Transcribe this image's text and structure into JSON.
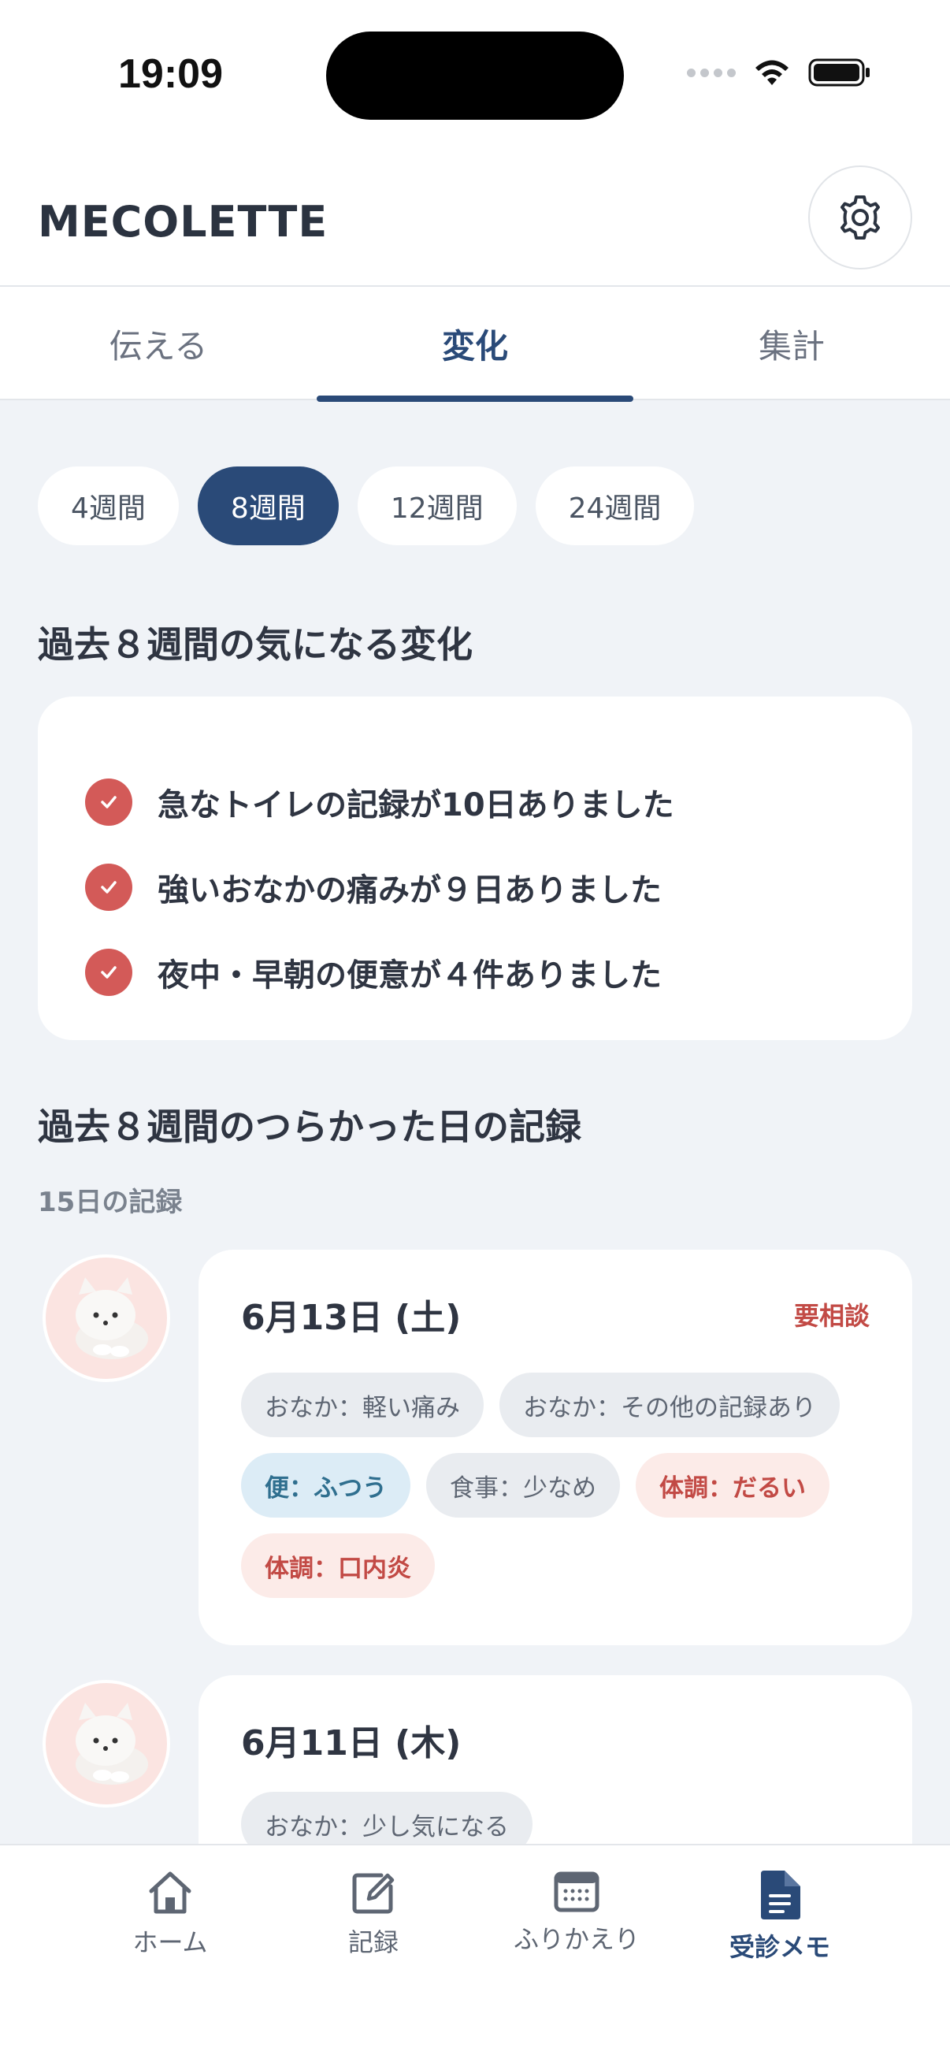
{
  "status_bar": {
    "time": "19:09"
  },
  "header": {
    "brand": "MECOLETTE"
  },
  "tabs": [
    {
      "label": "伝える",
      "active": false
    },
    {
      "label": "変化",
      "active": true
    },
    {
      "label": "集計",
      "active": false
    }
  ],
  "periods": [
    {
      "label": "4週間",
      "active": false
    },
    {
      "label": "8週間",
      "active": true
    },
    {
      "label": "12週間",
      "active": false
    },
    {
      "label": "24週間",
      "active": false
    }
  ],
  "changes": {
    "title": "過去８週間の気になる変化",
    "items": [
      "急なトイレの記録が10日ありました",
      "強いおなかの痛みが９日ありました",
      "夜中・早朝の便意が４件ありました"
    ]
  },
  "records": {
    "title": "過去８週間のつらかった日の記録",
    "count": "15日の記録",
    "entries": [
      {
        "date": "6月13日 (土)",
        "flag": "要相談",
        "tags": [
          "おなか：軽い痛み",
          "おなか：その他の記録あり",
          "便：ふつう",
          "食事：少なめ",
          "体調：だるい",
          "体調：口内炎"
        ]
      },
      {
        "date": "6月11日 (木)",
        "flag": "",
        "tags": [
          "おなか：少し気になる"
        ]
      }
    ]
  },
  "bottom_nav": [
    {
      "label": "ホーム",
      "icon": "home-icon",
      "active": false
    },
    {
      "label": "記録",
      "icon": "edit-icon",
      "active": false
    },
    {
      "label": "ふりかえり",
      "icon": "calendar-icon",
      "active": false
    },
    {
      "label": "受診メモ",
      "icon": "document-icon",
      "active": true
    }
  ],
  "colors": {
    "accent": "#2a4a78",
    "alert": "#d35a58",
    "background": "#f0f3f7"
  }
}
